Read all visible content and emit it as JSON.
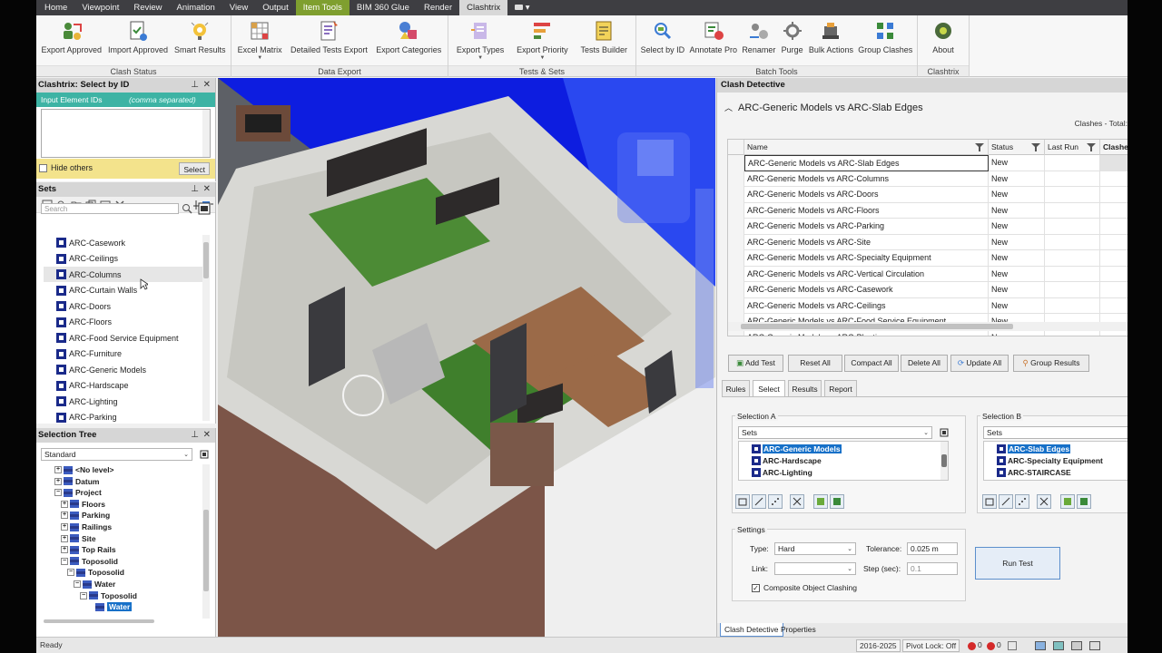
{
  "menubar": {
    "tabs": [
      "Home",
      "Viewpoint",
      "Review",
      "Animation",
      "View",
      "Output",
      "Item Tools",
      "BIM 360 Glue",
      "Render",
      "Clashtrix"
    ]
  },
  "ribbon": {
    "groups": [
      {
        "title": "Clash Status",
        "buttons": [
          "Export Approved",
          "Import Approved",
          "Smart Results"
        ]
      },
      {
        "title": "Data Export",
        "buttons": [
          "Excel Matrix",
          "Detailed Tests Export",
          "Export Categories"
        ]
      },
      {
        "title": "Tests & Sets",
        "buttons": [
          "Export Types",
          "Export Priority",
          "Tests Builder"
        ]
      },
      {
        "title": "Batch Tools",
        "buttons": [
          "Select by ID",
          "Annotate Pro",
          "Renamer",
          "Purge",
          "Bulk Actions",
          "Group Clashes"
        ]
      },
      {
        "title": "Clashtrix",
        "buttons": [
          "About"
        ]
      }
    ]
  },
  "select_by_id": {
    "title": "Clashtrix: Select by ID",
    "header_label": "Input Element IDs",
    "header_hint": "(comma separated)",
    "hide_others": "Hide others",
    "select_button": "Select"
  },
  "sets": {
    "title": "Sets",
    "search_placeholder": "Search",
    "items": [
      "ARC-Casework",
      "ARC-Ceilings",
      "ARC-Columns",
      "ARC-Curtain Walls",
      "ARC-Doors",
      "ARC-Floors",
      "ARC-Food Service Equipment",
      "ARC-Furniture",
      "ARC-Generic Models",
      "ARC-Hardscape",
      "ARC-Lighting",
      "ARC-Parking"
    ]
  },
  "selection_tree": {
    "title": "Selection Tree",
    "mode": "Standard",
    "rows": [
      "<No level>",
      "Datum",
      "Project",
      "Floors",
      "Parking",
      "Railings",
      "Site",
      "Top Rails",
      "Toposolid",
      "Toposolid",
      "Water",
      "Toposolid",
      "Water"
    ]
  },
  "clash_detective": {
    "title": "Clash Detective",
    "current_test": "ARC-Generic Models vs ARC-Slab Edges",
    "clashes_label": "Clashes -  Total:",
    "columns": [
      "Name",
      "Status",
      "Last Run",
      "Clashes"
    ],
    "tests": [
      {
        "name": "ARC-Generic Models vs ARC-Slab Edges",
        "status": "New"
      },
      {
        "name": "ARC-Generic Models vs ARC-Columns",
        "status": "New"
      },
      {
        "name": "ARC-Generic Models vs ARC-Doors",
        "status": "New"
      },
      {
        "name": "ARC-Generic Models vs ARC-Floors",
        "status": "New"
      },
      {
        "name": "ARC-Generic Models vs ARC-Parking",
        "status": "New"
      },
      {
        "name": "ARC-Generic Models vs ARC-Site",
        "status": "New"
      },
      {
        "name": "ARC-Generic Models vs ARC-Specialty Equipment",
        "status": "New"
      },
      {
        "name": "ARC-Generic Models vs ARC-Vertical Circulation",
        "status": "New"
      },
      {
        "name": "ARC-Generic Models vs ARC-Casework",
        "status": "New"
      },
      {
        "name": "ARC-Generic Models vs ARC-Ceilings",
        "status": "New"
      },
      {
        "name": "ARC-Generic Models vs ARC-Food Service Equipment",
        "status": "New"
      },
      {
        "name": "ARC-Generic Models vs ARC-Planting",
        "status": "New"
      }
    ],
    "actions": [
      "Add Test",
      "Reset All",
      "Compact All",
      "Delete All",
      "Update All",
      "Group Results"
    ],
    "tabs": [
      "Rules",
      "Select",
      "Results",
      "Report"
    ],
    "selection_a": {
      "title": "Selection A",
      "mode": "Sets",
      "items": [
        "ARC-Generic Models",
        "ARC-Hardscape",
        "ARC-Lighting"
      ]
    },
    "selection_b": {
      "title": "Selection B",
      "mode": "Sets",
      "items": [
        "ARC-Slab Edges",
        "ARC-Specialty Equipment",
        "ARC-STAIRCASE"
      ]
    },
    "settings": {
      "title": "Settings",
      "type_label": "Type:",
      "type_value": "Hard",
      "tolerance_label": "Tolerance:",
      "tolerance_value": "0.025 m",
      "link_label": "Link:",
      "link_value": "",
      "step_label": "Step (sec):",
      "step_value": "0.1",
      "composite": "Composite Object Clashing"
    },
    "run_button": "Run Test",
    "bottom_tabs": [
      "Clash Detective",
      "Properties"
    ]
  },
  "statusbar": {
    "left": "Ready",
    "year_range": "2016-2025",
    "pivot_lock": "Pivot Lock: Off",
    "count1": "0",
    "count2": "0"
  }
}
